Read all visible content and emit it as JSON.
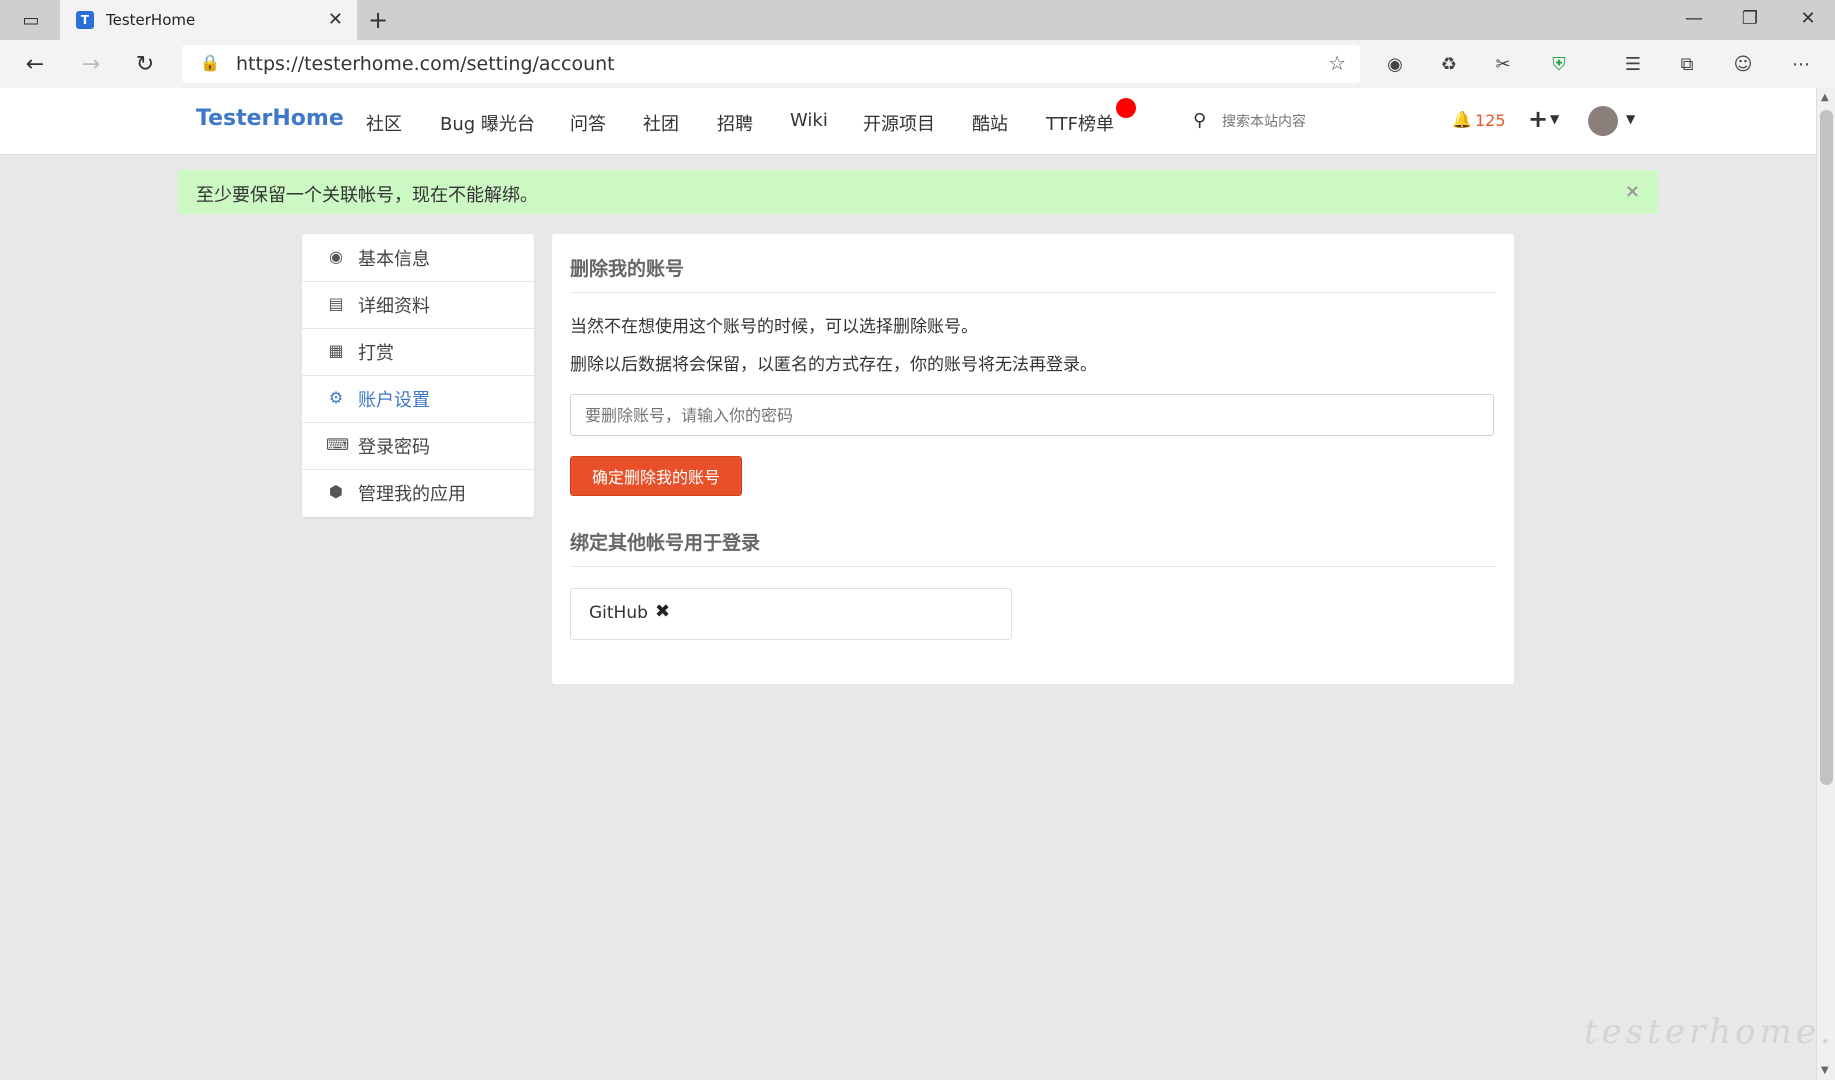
{
  "browser": {
    "tab_title": "TesterHome",
    "tab_favicon": "T",
    "url": "https://testerhome.com/setting/account"
  },
  "site": {
    "brand": "TesterHome",
    "nav": [
      "社区",
      "Bug 曝光台",
      "问答",
      "社团",
      "招聘",
      "Wiki",
      "开源项目",
      "酷站",
      "TTF榜单"
    ],
    "search_placeholder": "搜索本站内容",
    "notification_count": "125"
  },
  "alert": {
    "message": "至少要保留一个关联帐号，现在不能解绑。",
    "close": "×"
  },
  "sidebar": {
    "items": [
      {
        "label": "基本信息",
        "icon": "user-circle-icon"
      },
      {
        "label": "详细资料",
        "icon": "id-card-icon"
      },
      {
        "label": "打赏",
        "icon": "qrcode-icon"
      },
      {
        "label": "账户设置",
        "icon": "gear-icon",
        "active": true
      },
      {
        "label": "登录密码",
        "icon": "keyboard-icon"
      },
      {
        "label": "管理我的应用",
        "icon": "cube-icon"
      }
    ]
  },
  "main": {
    "delete_title": "删除我的账号",
    "delete_desc1": "当然不在想使用这个账号的时候，可以选择删除账号。",
    "delete_desc2": "删除以后数据将会保留，以匿名的方式存在，你的账号将无法再登录。",
    "password_placeholder": "要删除账号，请输入你的密码",
    "delete_button": "确定删除我的账号",
    "bind_title": "绑定其他帐号用于登录",
    "bound_accounts": [
      {
        "name": "GitHub"
      }
    ]
  },
  "watermark": "testerhome.com",
  "colors": {
    "brand": "#3f78c8",
    "danger": "#e8502a",
    "alert_bg": "#ccf8c4",
    "notification": "#e8562a"
  }
}
